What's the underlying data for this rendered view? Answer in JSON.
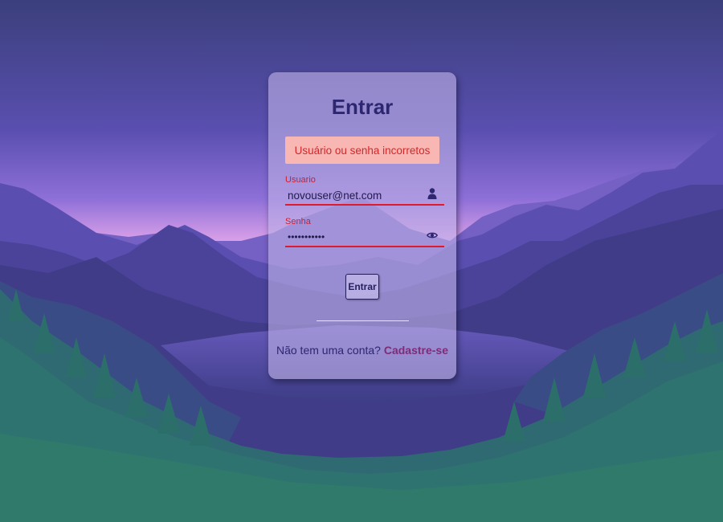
{
  "login": {
    "title": "Entrar",
    "error_message": "Usuário ou senha incorretos",
    "username": {
      "label": "Usuario",
      "value": "novouser@net.com",
      "icon": "user-icon"
    },
    "password": {
      "label": "Senha",
      "value": "•••••••••••",
      "icon": "eye-icon"
    },
    "submit_label": "Entrar",
    "signup_prompt": "Não tem uma conta?",
    "signup_link": "Cadastre-se"
  },
  "colors": {
    "error": "#e01a2a",
    "title": "#2d2670",
    "link": "#7e2c77",
    "alert_bg": "#f9b7b3"
  }
}
